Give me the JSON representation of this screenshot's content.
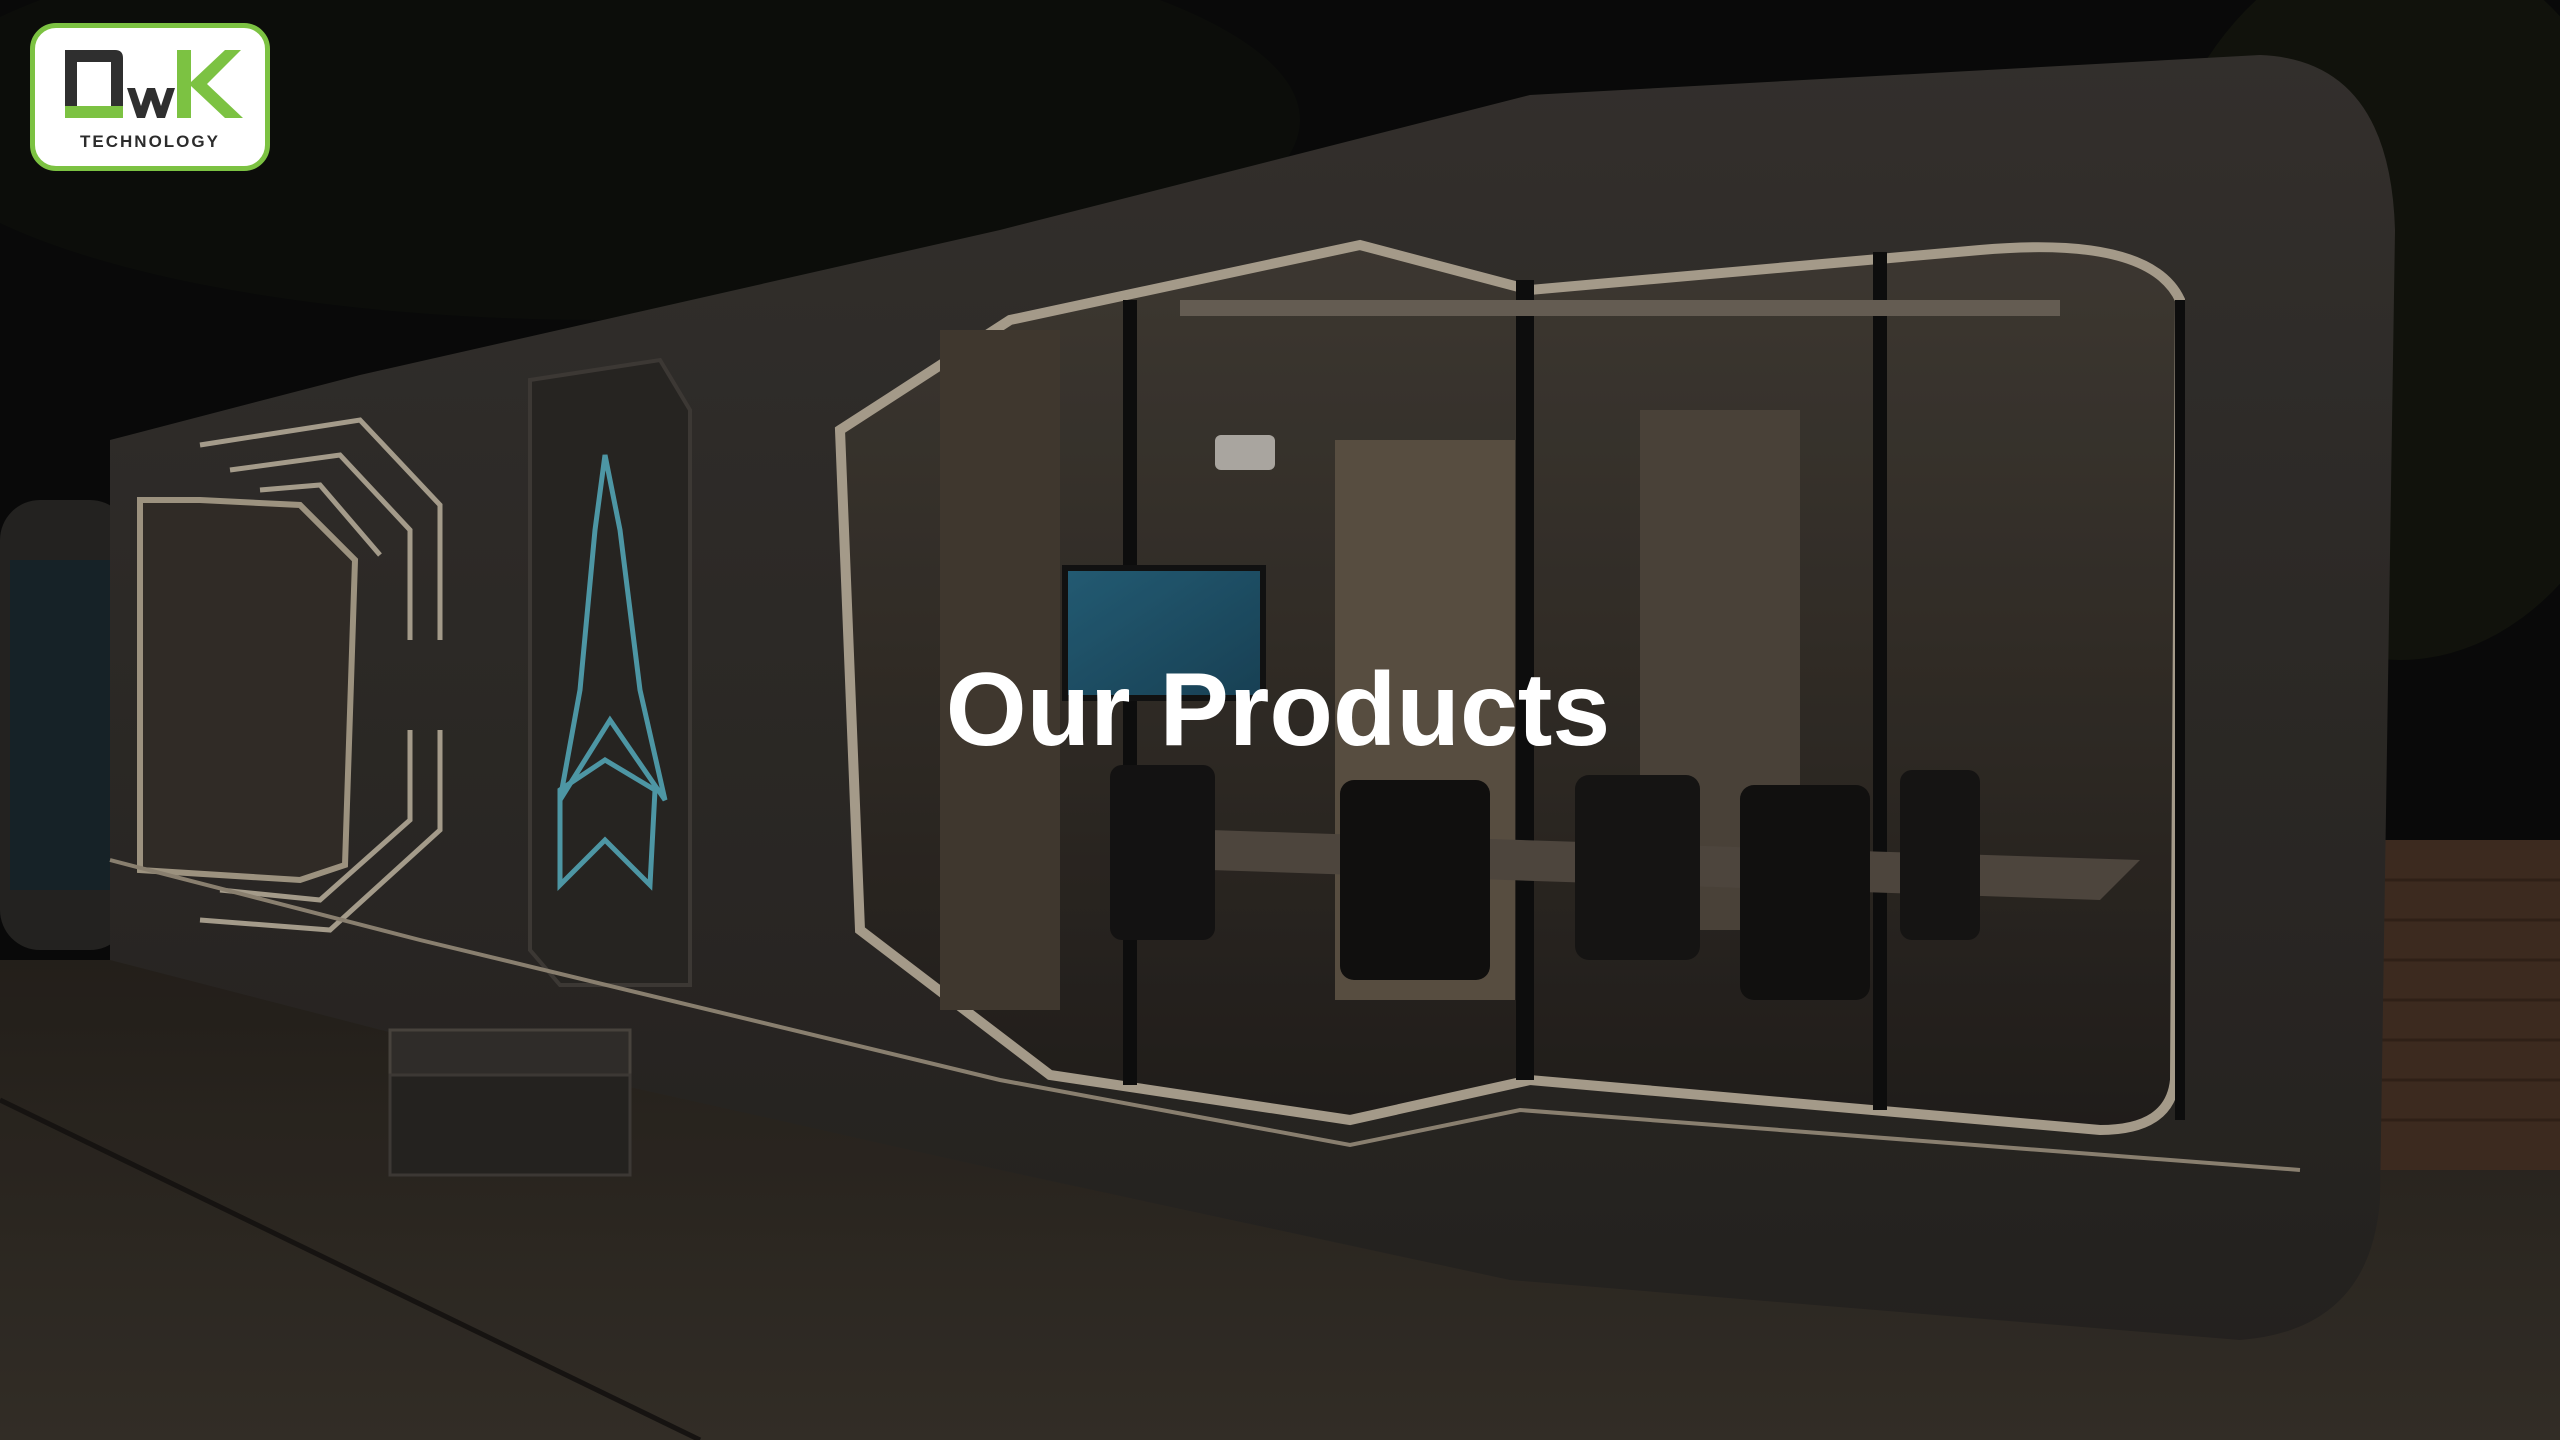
{
  "logo": {
    "mark_text": "QWK",
    "subtitle": "TECHNOLOGY",
    "border_color": "#7cc242",
    "icon": "qwk-logo-icon"
  },
  "slide": {
    "title": "Our Products"
  },
  "background": {
    "icon": "space-capsule-cabin-photo"
  }
}
